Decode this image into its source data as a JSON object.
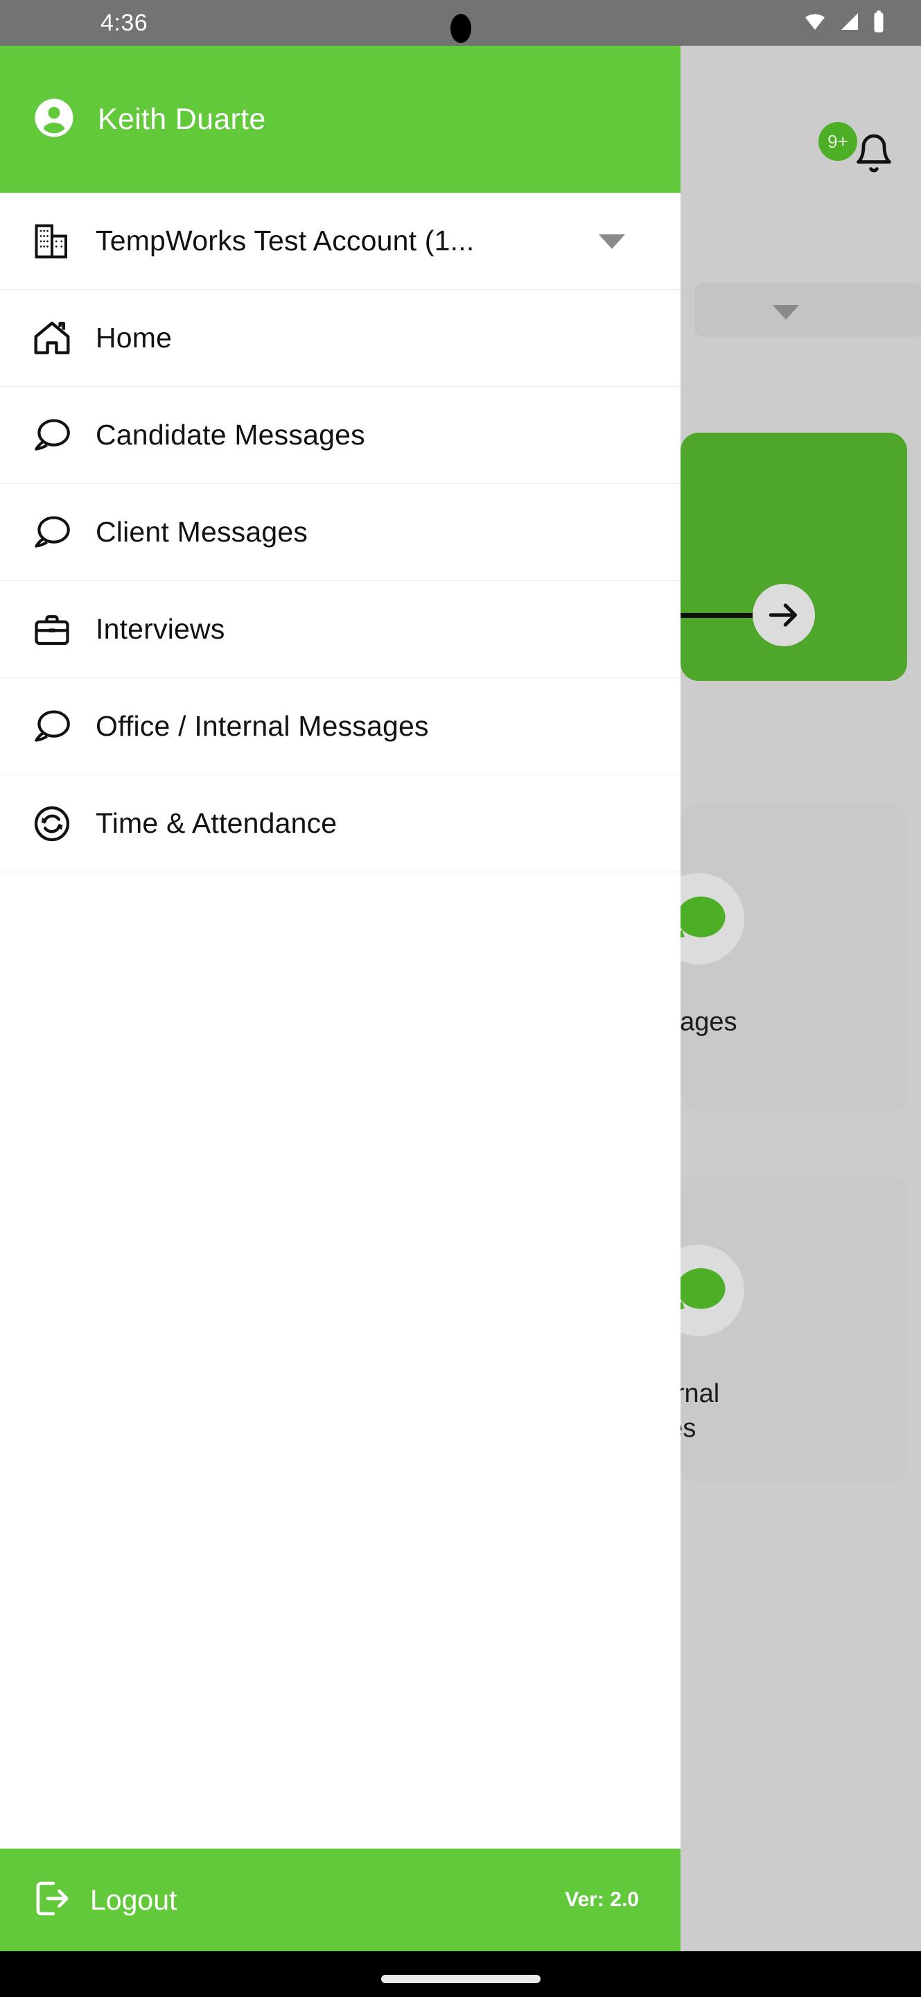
{
  "status_bar": {
    "time": "4:36",
    "icons": [
      "wifi-icon",
      "cellular-signal-icon",
      "battery-icon"
    ],
    "background_color": "#737373"
  },
  "theme": {
    "brand_green": "#62C93A",
    "card_green": "#4EA62A",
    "badge_green": "#4CAF26",
    "backdrop_gray": "#CCCCCC",
    "divider": "#EDEDED"
  },
  "drawer": {
    "header": {
      "user_name": "Keith Duarte",
      "avatar_icon": "user-circle-icon"
    },
    "account_selector": {
      "label": "TempWorks Test Account (1...",
      "icon": "office-building-icon",
      "caret_icon": "chevron-down-icon"
    },
    "menu_items": [
      {
        "label": "Home",
        "icon": "home-icon"
      },
      {
        "label": "Candidate Messages",
        "icon": "chat-bubble-icon"
      },
      {
        "label": "Client Messages",
        "icon": "chat-bubble-icon"
      },
      {
        "label": "Interviews",
        "icon": "briefcase-icon"
      },
      {
        "label": "Office / Internal Messages",
        "icon": "chat-bubble-icon"
      },
      {
        "label": "Time & Attendance",
        "icon": "sync-circle-icon"
      }
    ],
    "footer": {
      "logout_label": "Logout",
      "logout_icon": "logout-exit-icon",
      "version_label": "Ver: 2.0"
    }
  },
  "background_page": {
    "notification_badge": "9+",
    "notification_icon": "bell-icon",
    "dropdown_caret_icon": "chevron-down-icon",
    "green_card": {
      "arrow_icon": "arrow-right-icon"
    },
    "cards": [
      {
        "label_fragment": "essages",
        "icon": "chat-bubble-green-icon"
      },
      {
        "label_fragment": "nternal\nages",
        "icon": "chat-bubble-green-icon"
      }
    ]
  },
  "nav_bar": {
    "home_indicator": "home-indicator-pill"
  }
}
